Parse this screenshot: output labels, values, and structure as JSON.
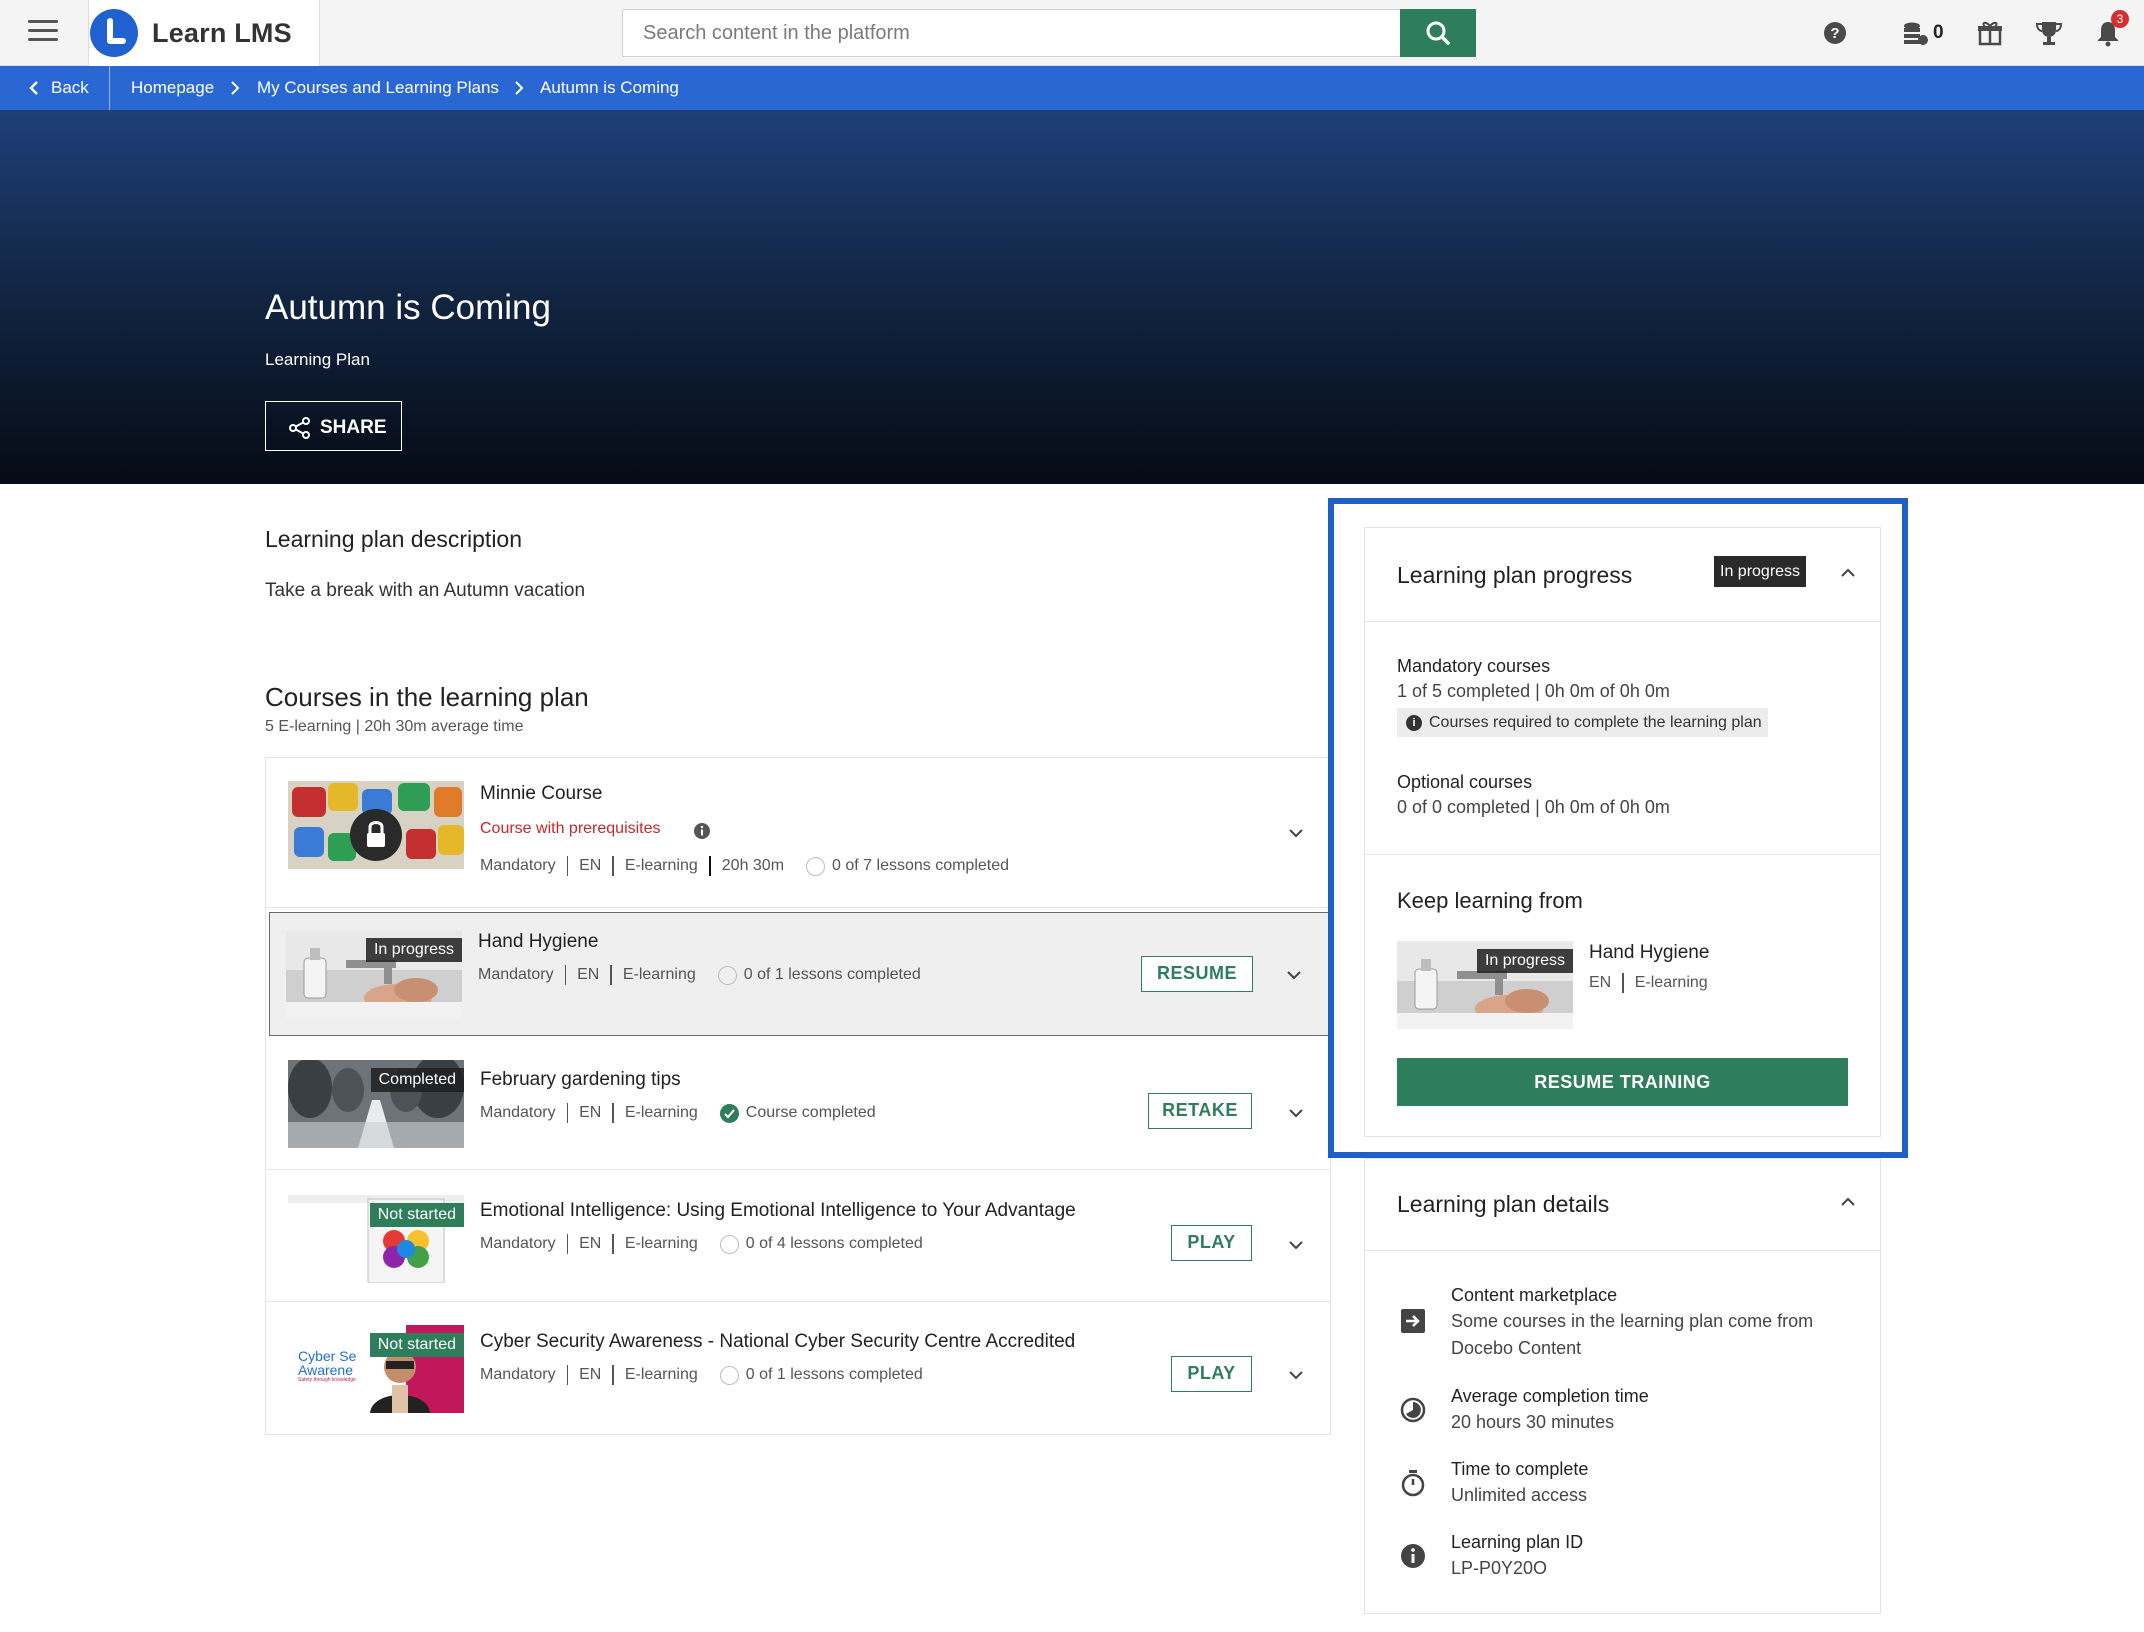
{
  "app": {
    "name": "Learn LMS",
    "search_placeholder": "Search content in the platform",
    "coins": "0",
    "notifications": "3"
  },
  "icons": {
    "menu": "hamburger-icon",
    "search": "search-icon",
    "help": "help-icon",
    "coins": "coins-icon",
    "gift": "gift-icon",
    "trophy": "trophy-icon",
    "bell": "bell-icon"
  },
  "colors": {
    "brand_blue": "#2b67d3",
    "action_green": "#2e7d5b",
    "prereq_red": "#c62828",
    "focus_frame": "#1f5fc6"
  },
  "breadcrumb": {
    "back": "Back",
    "items": [
      "Homepage",
      "My Courses and Learning Plans",
      "Autumn is Coming"
    ]
  },
  "hero": {
    "title": "Autumn is Coming",
    "type": "Learning Plan",
    "share": "SHARE"
  },
  "description": {
    "heading": "Learning plan description",
    "text": "Take a break with an Autumn vacation"
  },
  "courses": {
    "heading": "Courses in the learning plan",
    "summary": "5 E-learning | 20h 30m average time",
    "items": [
      {
        "title": "Minnie Course",
        "prereq": "Course with prerequisites",
        "badge": "",
        "meta": [
          "Mandatory",
          "EN",
          "E-learning",
          "20h 30m"
        ],
        "progress": "0 of 7 lessons completed",
        "action": ""
      },
      {
        "title": "Hand Hygiene",
        "badge": "In progress",
        "meta": [
          "Mandatory",
          "EN",
          "E-learning"
        ],
        "progress": "0 of 1 lessons completed",
        "action": "RESUME"
      },
      {
        "title": "February gardening tips",
        "badge": "Completed",
        "meta": [
          "Mandatory",
          "EN",
          "E-learning"
        ],
        "progress": "Course completed",
        "action": "RETAKE"
      },
      {
        "title": "Emotional Intelligence: Using Emotional Intelligence to Your Advantage",
        "badge": "Not started",
        "meta": [
          "Mandatory",
          "EN",
          "E-learning"
        ],
        "progress": "0 of 4 lessons completed",
        "action": "PLAY"
      },
      {
        "title": "Cyber Security Awareness - National Cyber Security Centre Accredited",
        "badge": "Not started",
        "thumb_text": [
          "Cyber Se",
          "Awarene",
          "Safety through knowledge"
        ],
        "meta": [
          "Mandatory",
          "EN",
          "E-learning"
        ],
        "progress": "0 of 1 lessons completed",
        "action": "PLAY"
      }
    ]
  },
  "progress_card": {
    "title": "Learning plan progress",
    "status": "In progress",
    "mandatory_label": "Mandatory courses",
    "mandatory_value": "1 of 5 completed | 0h 0m of 0h 0m",
    "mandatory_note": "Courses required to complete the learning plan",
    "optional_label": "Optional courses",
    "optional_value": "0 of 0 completed | 0h 0m of 0h 0m",
    "keep_title": "Keep learning from",
    "keep_course": "Hand Hygiene",
    "keep_badge": "In progress",
    "keep_meta": [
      "EN",
      "E-learning"
    ],
    "resume_button": "RESUME TRAINING"
  },
  "details_card": {
    "title": "Learning plan details",
    "items": [
      {
        "icon": "marketplace-icon",
        "label": "Content marketplace",
        "value": "Some courses in the learning plan come from Docebo Content"
      },
      {
        "icon": "clock-pie-icon",
        "label": "Average completion time",
        "value": "20 hours 30 minutes"
      },
      {
        "icon": "stopwatch-icon",
        "label": "Time to complete",
        "value": "Unlimited access"
      },
      {
        "icon": "info-icon",
        "label": "Learning plan ID",
        "value": "LP-P0Y20O"
      }
    ]
  }
}
